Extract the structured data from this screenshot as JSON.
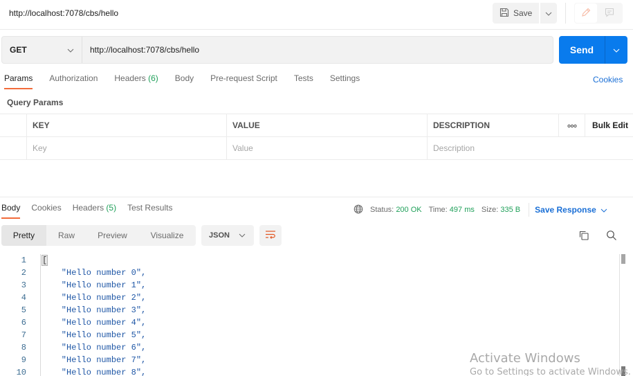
{
  "header": {
    "request_title": "http://localhost:7078/cbs/hello",
    "save_label": "Save",
    "icons": {
      "save": "floppy-disk-icon",
      "dropdown": "chevron-down-icon",
      "edit": "pencil-icon",
      "comment": "comment-icon"
    }
  },
  "request": {
    "method": "GET",
    "url": "http://localhost:7078/cbs/hello",
    "send_label": "Send"
  },
  "request_tabs": [
    {
      "label": "Params",
      "active": true
    },
    {
      "label": "Authorization"
    },
    {
      "label": "Headers",
      "count": "(6)"
    },
    {
      "label": "Body"
    },
    {
      "label": "Pre-request Script"
    },
    {
      "label": "Tests"
    },
    {
      "label": "Settings"
    }
  ],
  "cookies_link": "Cookies",
  "query_params": {
    "title": "Query Params",
    "columns": [
      "KEY",
      "VALUE",
      "DESCRIPTION"
    ],
    "more_label": "ooo",
    "bulk_edit": "Bulk Edit",
    "placeholders": {
      "key": "Key",
      "value": "Value",
      "description": "Description"
    }
  },
  "response_tabs": [
    {
      "label": "Body",
      "active": true
    },
    {
      "label": "Cookies"
    },
    {
      "label": "Headers",
      "count": "(5)"
    },
    {
      "label": "Test Results"
    }
  ],
  "response_meta": {
    "status_label": "Status:",
    "status_value": "200 OK",
    "time_label": "Time:",
    "time_value": "497 ms",
    "size_label": "Size:",
    "size_value": "335 B",
    "save_response": "Save Response"
  },
  "view_modes": [
    "Pretty",
    "Raw",
    "Preview",
    "Visualize"
  ],
  "active_view": "Pretty",
  "language": "JSON",
  "code_lines": [
    "[",
    "    \"Hello number 0\",",
    "    \"Hello number 1\",",
    "    \"Hello number 2\",",
    "    \"Hello number 3\",",
    "    \"Hello number 4\",",
    "    \"Hello number 5\",",
    "    \"Hello number 6\",",
    "    \"Hello number 7\",",
    "    \"Hello number 8\","
  ],
  "line_numbers": [
    "1",
    "2",
    "3",
    "4",
    "5",
    "6",
    "7",
    "8",
    "9",
    "10"
  ],
  "watermark": {
    "title": "Activate Windows",
    "subtitle": "Go to Settings to activate Windows."
  },
  "colors": {
    "accent": "#f26b3a",
    "send": "#097bed",
    "link": "#1a6fd6",
    "success": "#20a05a"
  }
}
